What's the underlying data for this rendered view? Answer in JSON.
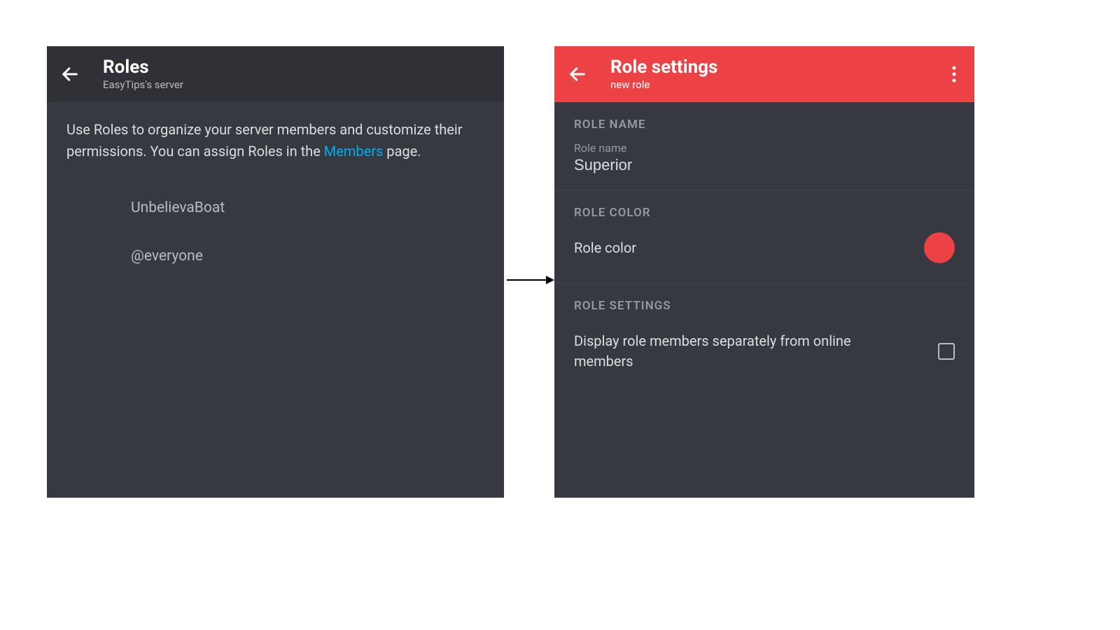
{
  "left": {
    "title": "Roles",
    "subtitle": "EasyTips's server",
    "description_pre": "Use Roles to organize your server members and customize their permissions. You can assign Roles in the ",
    "description_link": "Members",
    "description_post": " page.",
    "roles": [
      {
        "name": "UnbelievaBoat"
      },
      {
        "name": "@everyone"
      }
    ]
  },
  "right": {
    "title": "Role settings",
    "subtitle": "new role",
    "section_role_name": "ROLE NAME",
    "field_role_name_label": "Role name",
    "field_role_name_value": "Superior",
    "section_role_color": "ROLE COLOR",
    "role_color_label": "Role color",
    "role_color_value": "#ed4245",
    "section_role_settings": "ROLE SETTINGS",
    "display_separately_label": "Display role members separately from online members",
    "display_separately_checked": false
  }
}
